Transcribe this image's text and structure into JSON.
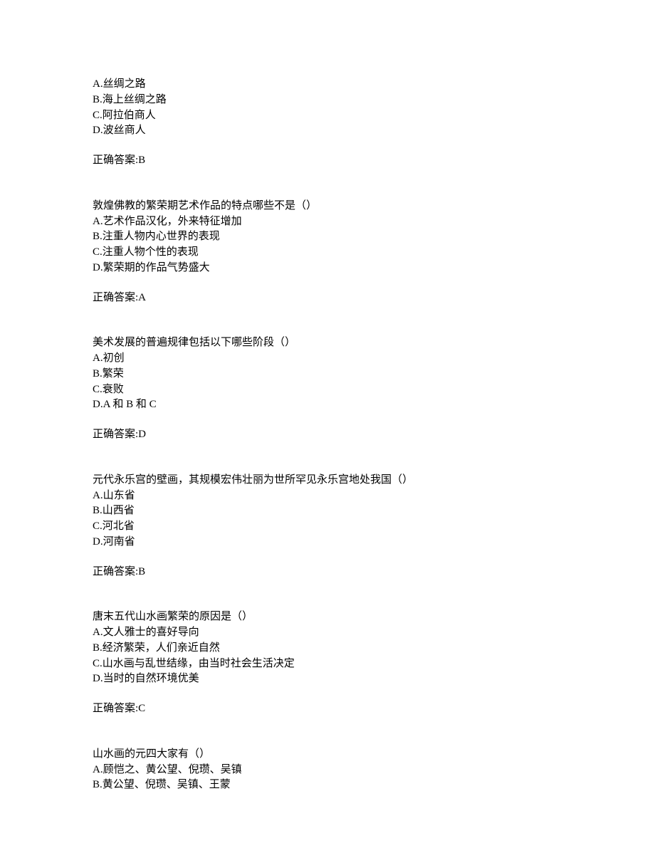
{
  "questions": [
    {
      "stem": "",
      "options": [
        "A.丝绸之路",
        "B.海上丝绸之路",
        "C.阿拉伯商人",
        "D.波丝商人"
      ],
      "answer": "正确答案:B"
    },
    {
      "stem": "敦煌佛教的繁荣期艺术作品的特点哪些不是（）",
      "options": [
        "A.艺术作品汉化，外来特征增加",
        "B.注重人物内心世界的表现",
        "C.注重人物个性的表现",
        "D.繁荣期的作品气势盛大"
      ],
      "answer": "正确答案:A"
    },
    {
      "stem": "美术发展的普遍规律包括以下哪些阶段（）",
      "options": [
        "A.初创",
        "B.繁荣",
        "C.衰败",
        "D.A 和 B 和 C"
      ],
      "answer": "正确答案:D"
    },
    {
      "stem": "元代永乐宫的壁画，其规模宏伟壮丽为世所罕见永乐宫地处我国（）",
      "options": [
        "A.山东省",
        "B.山西省",
        "C.河北省",
        "D.河南省"
      ],
      "answer": "正确答案:B"
    },
    {
      "stem": "唐末五代山水画繁荣的原因是（）",
      "options": [
        "A.文人雅士的喜好导向",
        "B.经济繁荣，人们亲近自然",
        "C.山水画与乱世结缘，由当时社会生活决定",
        "D.当时的自然环境优美"
      ],
      "answer": "正确答案:C"
    },
    {
      "stem": "山水画的元四大家有（）",
      "options": [
        "A.顾恺之、黄公望、倪瓒、吴镇",
        "B.黄公望、倪瓒、吴镇、王蒙"
      ],
      "answer": ""
    }
  ]
}
